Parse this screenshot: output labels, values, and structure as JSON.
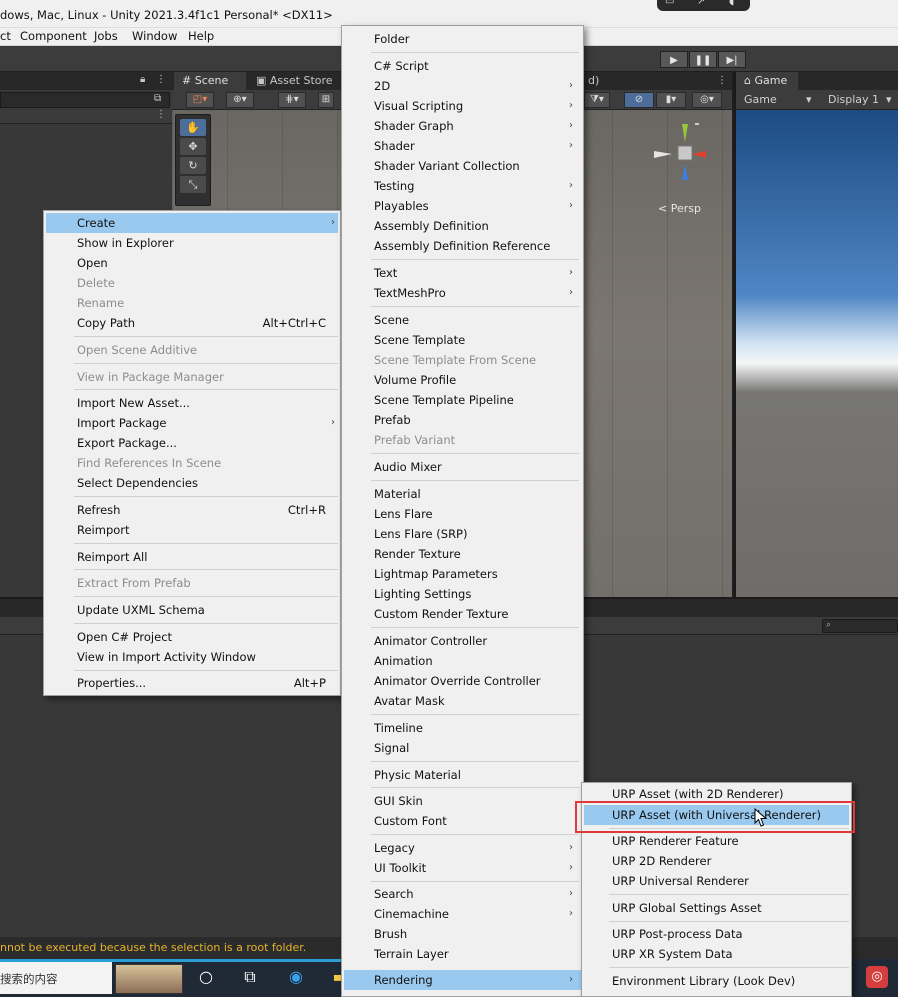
{
  "window": {
    "title": "dows, Mac, Linux - Unity 2021.3.4f1c1 Personal* <DX11>"
  },
  "menubar": {
    "items": [
      "ct",
      "Component",
      "Jobs",
      "Window",
      "Help"
    ]
  },
  "scene": {
    "tabs": [
      "Scene",
      "Asset Store"
    ],
    "tab_fragment": "d)",
    "persp_label": "< Persp",
    "gizmo_axes": {
      "x_color": "#e0402f",
      "y_color": "#96c83d",
      "z_color": "#3d7fe0"
    }
  },
  "game": {
    "tab": "Game",
    "display_dropdown": "Game",
    "display_select": "Display 1"
  },
  "context_menu": {
    "items": [
      {
        "label": "Create",
        "arrow": "›",
        "highlighted": true
      },
      {
        "label": "Show in Explorer"
      },
      {
        "label": "Open"
      },
      {
        "label": "Delete",
        "disabled": true
      },
      {
        "label": "Rename",
        "disabled": true
      },
      {
        "label": "Copy Path",
        "shortcut": "Alt+Ctrl+C"
      },
      {
        "label": "Open Scene Additive",
        "disabled": true
      },
      {
        "label": "View in Package Manager",
        "disabled": true
      },
      {
        "label": "Import New Asset..."
      },
      {
        "label": "Import Package",
        "arrow": "›"
      },
      {
        "label": "Export Package..."
      },
      {
        "label": "Find References In Scene",
        "disabled": true
      },
      {
        "label": "Select Dependencies"
      },
      {
        "label": "Refresh",
        "shortcut": "Ctrl+R"
      },
      {
        "label": "Reimport"
      },
      {
        "label": "Reimport All"
      },
      {
        "label": "Extract From Prefab",
        "disabled": true
      },
      {
        "label": "Update UXML Schema"
      },
      {
        "label": "Open C# Project"
      },
      {
        "label": "View in Import Activity Window"
      },
      {
        "label": "Properties...",
        "shortcut": "Alt+P"
      }
    ]
  },
  "create_menu": {
    "items": [
      {
        "label": "Folder"
      },
      {
        "label": "C# Script"
      },
      {
        "label": "2D",
        "arrow": "›"
      },
      {
        "label": "Visual Scripting",
        "arrow": "›"
      },
      {
        "label": "Shader Graph",
        "arrow": "›"
      },
      {
        "label": "Shader",
        "arrow": "›"
      },
      {
        "label": "Shader Variant Collection"
      },
      {
        "label": "Testing",
        "arrow": "›"
      },
      {
        "label": "Playables",
        "arrow": "›"
      },
      {
        "label": "Assembly Definition"
      },
      {
        "label": "Assembly Definition Reference"
      },
      {
        "label": "Text",
        "arrow": "›"
      },
      {
        "label": "TextMeshPro",
        "arrow": "›"
      },
      {
        "label": "Scene"
      },
      {
        "label": "Scene Template"
      },
      {
        "label": "Scene Template From Scene",
        "disabled": true
      },
      {
        "label": "Volume Profile"
      },
      {
        "label": "Scene Template Pipeline"
      },
      {
        "label": "Prefab"
      },
      {
        "label": "Prefab Variant",
        "disabled": true
      },
      {
        "label": "Audio Mixer"
      },
      {
        "label": "Material"
      },
      {
        "label": "Lens Flare"
      },
      {
        "label": "Lens Flare (SRP)"
      },
      {
        "label": "Render Texture"
      },
      {
        "label": "Lightmap Parameters"
      },
      {
        "label": "Lighting Settings"
      },
      {
        "label": "Custom Render Texture"
      },
      {
        "label": "Animator Controller"
      },
      {
        "label": "Animation"
      },
      {
        "label": "Animator Override Controller"
      },
      {
        "label": "Avatar Mask"
      },
      {
        "label": "Timeline"
      },
      {
        "label": "Signal"
      },
      {
        "label": "Physic Material"
      },
      {
        "label": "GUI Skin"
      },
      {
        "label": "Custom Font"
      },
      {
        "label": "Legacy",
        "arrow": "›"
      },
      {
        "label": "UI Toolkit",
        "arrow": "›"
      },
      {
        "label": "Search",
        "arrow": "›"
      },
      {
        "label": "Cinemachine",
        "arrow": "›"
      },
      {
        "label": "Brush"
      },
      {
        "label": "Terrain Layer"
      },
      {
        "label": "Rendering",
        "arrow": "›",
        "highlighted": true
      }
    ]
  },
  "rendering_menu": {
    "items": [
      {
        "label": "URP Asset (with 2D Renderer)"
      },
      {
        "label": "URP Asset (with Universal Renderer)",
        "highlighted": true
      },
      {
        "label": "URP Renderer Feature"
      },
      {
        "label": "URP 2D Renderer"
      },
      {
        "label": "URP Universal Renderer"
      },
      {
        "label": "URP Global Settings Asset"
      },
      {
        "label": "URP Post-process Data"
      },
      {
        "label": "URP XR System Data"
      },
      {
        "label": "Environment Library (Look Dev)"
      }
    ]
  },
  "status_bar": {
    "message": "nnot be executed because the selection is a root folder."
  },
  "taskbar": {
    "search_text": "搜索的内容",
    "icons": [
      "cortana-icon",
      "task-view-icon",
      "edge-icon",
      "file-explorer-icon",
      "netease-music-icon"
    ]
  },
  "colors": {
    "menu_bg": "#f0f0f0",
    "menu_highlight": "#99c9ef",
    "disabled_text": "#8d8d8d",
    "annotation_box": "#e0383b",
    "status_warning": "#e6b330"
  }
}
